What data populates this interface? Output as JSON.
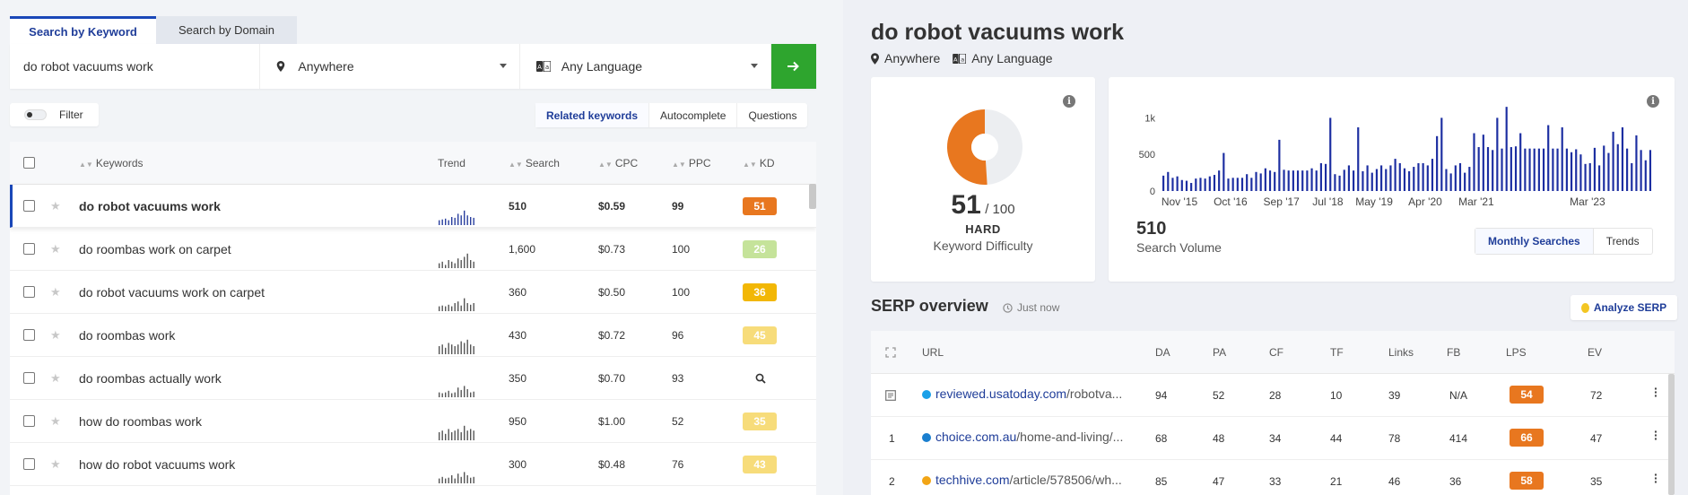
{
  "left": {
    "tabs": [
      {
        "label": "Search by Keyword",
        "active": true
      },
      {
        "label": "Search by Domain",
        "active": false
      }
    ],
    "search": {
      "value": "do robot vacuums work",
      "location": "Anywhere",
      "language": "Any Language"
    },
    "filter_label": "Filter",
    "modes": [
      "Related keywords",
      "Autocomplete",
      "Questions"
    ],
    "columns": {
      "keywords": "Keywords",
      "trend": "Trend",
      "search": "Search",
      "cpc": "CPC",
      "ppc": "PPC",
      "kd": "KD"
    },
    "rows": [
      {
        "keyword": "do robot vacuums work",
        "search": "510",
        "cpc": "$0.59",
        "ppc": "99",
        "kd": "51",
        "kd_color": "#e8771f",
        "selected": true,
        "trend": [
          0.3,
          0.35,
          0.4,
          0.3,
          0.5,
          0.45,
          0.7,
          0.6,
          0.9,
          0.6,
          0.5,
          0.45
        ]
      },
      {
        "keyword": "do roombas work on carpet",
        "search": "1,600",
        "cpc": "$0.73",
        "ppc": "100",
        "kd": "26",
        "kd_color": "#c5e39a",
        "selected": false,
        "trend": [
          0.3,
          0.4,
          0.2,
          0.5,
          0.4,
          0.3,
          0.6,
          0.5,
          0.7,
          0.9,
          0.5,
          0.4
        ]
      },
      {
        "keyword": "do robot vacuums work on carpet",
        "search": "360",
        "cpc": "$0.50",
        "ppc": "100",
        "kd": "36",
        "kd_color": "#f2b705",
        "selected": false,
        "trend": [
          0.3,
          0.35,
          0.3,
          0.4,
          0.3,
          0.5,
          0.6,
          0.35,
          0.8,
          0.5,
          0.4,
          0.5
        ]
      },
      {
        "keyword": "do roombas work",
        "search": "430",
        "cpc": "$0.72",
        "ppc": "96",
        "kd": "45",
        "kd_color": "#f7dc7a",
        "selected": false,
        "trend": [
          0.5,
          0.6,
          0.4,
          0.7,
          0.6,
          0.5,
          0.6,
          0.8,
          0.7,
          0.9,
          0.6,
          0.5
        ]
      },
      {
        "keyword": "do roombas actually work",
        "search": "350",
        "cpc": "$0.70",
        "ppc": "93",
        "kd": "",
        "kd_color": "",
        "selected": false,
        "trend": [
          0.3,
          0.25,
          0.3,
          0.4,
          0.25,
          0.3,
          0.6,
          0.45,
          0.7,
          0.5,
          0.3,
          0.35
        ]
      },
      {
        "keyword": "how do roombas work",
        "search": "950",
        "cpc": "$1.00",
        "ppc": "52",
        "kd": "35",
        "kd_color": "#f7dc7a",
        "selected": false,
        "trend": [
          0.5,
          0.6,
          0.4,
          0.7,
          0.5,
          0.6,
          0.7,
          0.5,
          0.9,
          0.6,
          0.7,
          0.6
        ]
      },
      {
        "keyword": "how do robot vacuums work",
        "search": "300",
        "cpc": "$0.48",
        "ppc": "76",
        "kd": "43",
        "kd_color": "#f7dc7a",
        "selected": false,
        "trend": [
          0.3,
          0.4,
          0.3,
          0.35,
          0.5,
          0.3,
          0.6,
          0.4,
          0.7,
          0.5,
          0.35,
          0.4
        ]
      }
    ]
  },
  "right": {
    "title": "do robot vacuums work",
    "location": "Anywhere",
    "language": "Any Language",
    "kd_card": {
      "value": "51",
      "max": "/ 100",
      "level": "HARD",
      "caption": "Keyword Difficulty",
      "fraction": 0.51,
      "color": "#e8771f"
    },
    "volume_card": {
      "value": "510",
      "caption": "Search Volume",
      "tabs": [
        "Monthly Searches",
        "Trends"
      ],
      "y_ticks": [
        "1k",
        "500",
        "0"
      ],
      "x_ticks": [
        "Nov '15",
        "Oct '16",
        "Sep '17",
        "Jul '18",
        "May '19",
        "Apr '20",
        "Mar '21",
        "Mar '23"
      ]
    },
    "serp": {
      "title": "SERP overview",
      "time": "Just now",
      "analyze_label": "Analyze SERP",
      "columns": [
        "URL",
        "DA",
        "PA",
        "CF",
        "TF",
        "Links",
        "FB",
        "LPS",
        "EV"
      ],
      "rows": [
        {
          "rank": "",
          "domain": "reviewed.usatoday.com",
          "path": "/robotva...",
          "fav_color": "#1aa0e8",
          "da": "94",
          "pa": "52",
          "cf": "28",
          "tf": "10",
          "links": "39",
          "fb": "N/A",
          "lps": "54",
          "ev": "72"
        },
        {
          "rank": "1",
          "domain": "choice.com.au",
          "path": "/home-and-living/...",
          "fav_color": "#1a7fcf",
          "da": "68",
          "pa": "48",
          "cf": "34",
          "tf": "44",
          "links": "78",
          "fb": "414",
          "lps": "66",
          "ev": "47"
        },
        {
          "rank": "2",
          "domain": "techhive.com",
          "path": "/article/578506/wh...",
          "fav_color": "#f2a516",
          "da": "85",
          "pa": "47",
          "cf": "33",
          "tf": "21",
          "links": "46",
          "fb": "36",
          "lps": "58",
          "ev": "35"
        }
      ]
    }
  },
  "chart_data": {
    "type": "bar",
    "title": "",
    "xlabel": "",
    "ylabel": "",
    "ylim": [
      0,
      1250
    ],
    "x_ticks": [
      "Nov '15",
      "Oct '16",
      "Sep '17",
      "Jul '18",
      "May '19",
      "Apr '20",
      "Mar '21",
      "Mar '23"
    ],
    "values": [
      210,
      260,
      180,
      200,
      150,
      140,
      110,
      170,
      180,
      170,
      200,
      220,
      280,
      520,
      170,
      180,
      180,
      180,
      230,
      180,
      260,
      240,
      310,
      280,
      260,
      700,
      290,
      280,
      280,
      280,
      280,
      280,
      310,
      280,
      380,
      370,
      1000,
      230,
      210,
      290,
      350,
      280,
      870,
      270,
      350,
      250,
      300,
      350,
      300,
      350,
      440,
      380,
      310,
      270,
      330,
      380,
      380,
      350,
      440,
      750,
      1000,
      300,
      240,
      350,
      380,
      250,
      330,
      790,
      600,
      770,
      600,
      560,
      1000,
      580,
      1150,
      600,
      610,
      790,
      580,
      580,
      580,
      580,
      580,
      900,
      580,
      580,
      870,
      580,
      530,
      570,
      500,
      370,
      380,
      590,
      350,
      620,
      520,
      810,
      640,
      870,
      580,
      380,
      760,
      560,
      420,
      560
    ]
  }
}
